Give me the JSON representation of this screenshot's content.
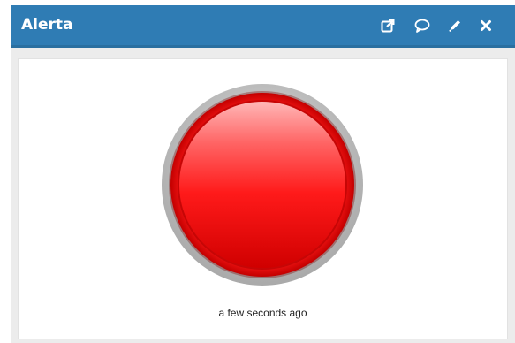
{
  "window": {
    "title": "Alerta"
  },
  "toolbar": {
    "icons": [
      "external-link-icon",
      "comment-icon",
      "pencil-icon",
      "close-icon"
    ]
  },
  "alert": {
    "state_color": "#ff0000",
    "timestamp": "a few seconds ago"
  },
  "colors": {
    "header": "#2f7cb4",
    "background": "#ececec",
    "led_red": "#ff0000",
    "led_ring": "#c8c8c8"
  }
}
